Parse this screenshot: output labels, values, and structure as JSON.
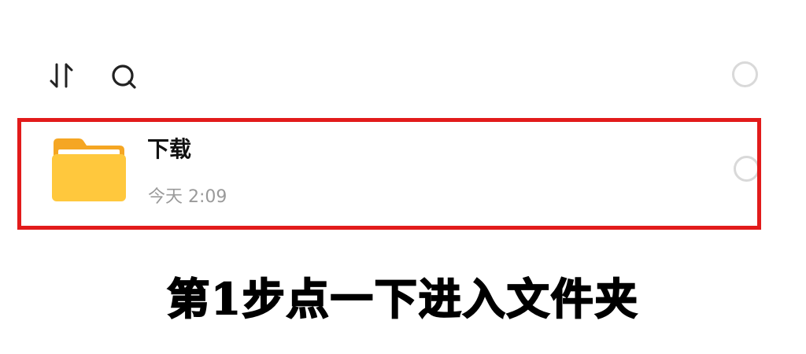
{
  "toolbar": {
    "sort_icon": "sort-icon",
    "search_icon": "search-icon",
    "select_all_state": "unchecked"
  },
  "folder": {
    "name": "下载",
    "modified": "今天 2:09",
    "icon": "folder-icon",
    "icon_color": "#FFC83D",
    "selected": false
  },
  "caption": "第1步点一下进入文件夹",
  "colors": {
    "highlight": "#E21B1B",
    "meta_text": "#9A9A9A",
    "circle_border": "#D9D9D9"
  }
}
